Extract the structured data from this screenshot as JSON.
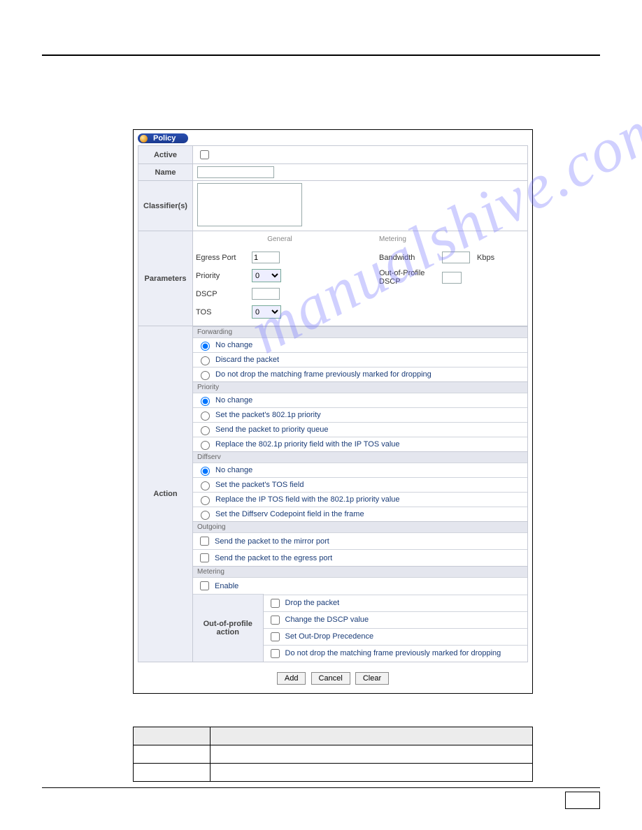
{
  "header": {
    "title": "Policy"
  },
  "labels": {
    "active": "Active",
    "name": "Name",
    "classifiers": "Classifier(s)",
    "parameters": "Parameters",
    "action": "Action",
    "general": "General",
    "metering": "Metering",
    "egress_port": "Egress Port",
    "priority": "Priority",
    "dscp": "DSCP",
    "tos": "TOS",
    "bandwidth": "Bandwidth",
    "kbps": "Kbps",
    "out_profile_dscp": "Out-of-Profile DSCP",
    "out_profile_action": "Out-of-profile action"
  },
  "values": {
    "active_checked": false,
    "name": "",
    "classifiers": "",
    "egress_port": "1",
    "priority": "0",
    "dscp": "",
    "tos": "0",
    "bandwidth": "",
    "out_profile_dscp": ""
  },
  "action": {
    "forwarding": {
      "header": "Forwarding",
      "options": [
        "No change",
        "Discard the packet",
        "Do not drop the matching frame previously marked for dropping"
      ],
      "selected": 0
    },
    "priority": {
      "header": "Priority",
      "options": [
        "No change",
        "Set the packet's 802.1p priority",
        "Send the packet to priority queue",
        "Replace the 802.1p priority field with the IP TOS value"
      ],
      "selected": 0
    },
    "diffserv": {
      "header": "Diffserv",
      "options": [
        "No change",
        "Set the packet's TOS field",
        "Replace the IP TOS field with the 802.1p priority value",
        "Set the Diffserv Codepoint field in the frame"
      ],
      "selected": 0
    },
    "outgoing": {
      "header": "Outgoing",
      "options": [
        "Send the packet to the mirror port",
        "Send the packet to the egress port"
      ],
      "checked": [
        false,
        false
      ]
    },
    "metering": {
      "header": "Metering",
      "enable_label": "Enable",
      "enable": false,
      "out_profile": {
        "options": [
          "Drop the packet",
          "Change the DSCP value",
          "Set Out-Drop Precedence",
          "Do not drop the matching frame previously marked for dropping"
        ],
        "checked": [
          false,
          false,
          false,
          false
        ]
      }
    }
  },
  "buttons": {
    "add": "Add",
    "cancel": "Cancel",
    "clear": "Clear"
  },
  "watermark": "manualshive.com"
}
